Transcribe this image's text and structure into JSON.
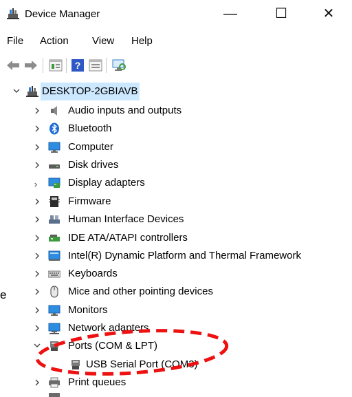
{
  "window": {
    "title": "Device Manager",
    "minimize_glyph": "—",
    "maximize_glyph": "☐",
    "close_glyph": "✕"
  },
  "menu": {
    "file": "File",
    "action": "Action",
    "view": "View",
    "help": "Help"
  },
  "toolbar": {
    "icons": [
      "back-arrow-icon",
      "forward-arrow-icon",
      "properties-icon",
      "help-icon",
      "update-driver-icon",
      "scan-hardware-icon"
    ]
  },
  "tree": {
    "root": {
      "label": "DESKTOP-2GBIAVB",
      "expanded": true,
      "selected": true
    },
    "categories": [
      {
        "label": "Audio inputs and outputs",
        "icon": "speaker-icon"
      },
      {
        "label": "Bluetooth",
        "icon": "bluetooth-icon"
      },
      {
        "label": "Computer",
        "icon": "monitor-icon"
      },
      {
        "label": "Disk drives",
        "icon": "disk-drive-icon"
      },
      {
        "label": "Display adapters",
        "icon": "display-adapter-icon"
      },
      {
        "label": "Firmware",
        "icon": "firmware-chip-icon"
      },
      {
        "label": "Human Interface Devices",
        "icon": "hid-icon"
      },
      {
        "label": "IDE ATA/ATAPI controllers",
        "icon": "ide-controller-icon"
      },
      {
        "label": "Intel(R) Dynamic Platform and Thermal Framework",
        "icon": "intel-framework-icon"
      },
      {
        "label": "Keyboards",
        "icon": "keyboard-icon"
      },
      {
        "label": "Mice and other pointing devices",
        "icon": "mouse-icon"
      },
      {
        "label": "Monitors",
        "icon": "monitor-icon"
      },
      {
        "label": "Network adapters",
        "icon": "network-adapter-icon"
      },
      {
        "label": "Ports (COM & LPT)",
        "icon": "port-connector-icon",
        "expanded": true,
        "children": [
          {
            "label": "USB Serial Port (COM3)",
            "icon": "port-connector-icon"
          }
        ]
      },
      {
        "label": "Print queues",
        "icon": "printer-icon"
      }
    ]
  },
  "side_text": "e",
  "colors": {
    "selection": "#cce8ff",
    "annotation": "#ee1111",
    "accent": "#0078d7"
  }
}
